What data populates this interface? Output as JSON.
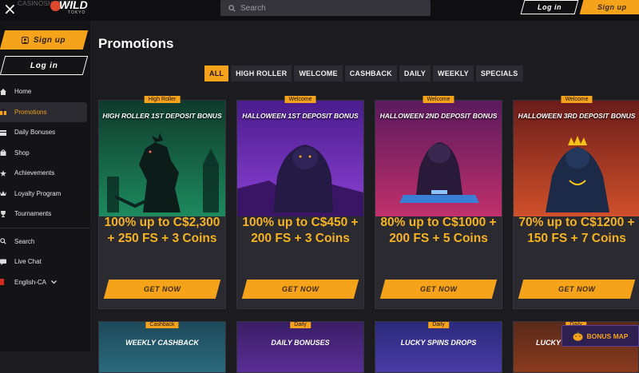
{
  "topbar": {
    "watermark": "CASINOSHUNTER",
    "logo_main": "WILD",
    "logo_sub": "TOKYO",
    "search_placeholder": "Search",
    "login": "Log in",
    "signup": "Sign up"
  },
  "sidebar": {
    "signup": "Sign up",
    "login": "Log in",
    "items": [
      {
        "label": "Home",
        "icon": "home-icon"
      },
      {
        "label": "Promotions",
        "icon": "gift-icon",
        "active": true
      },
      {
        "label": "Daily Bonuses",
        "icon": "calendar-icon"
      },
      {
        "label": "Shop",
        "icon": "bag-icon"
      },
      {
        "label": "Achievements",
        "icon": "star-icon"
      },
      {
        "label": "Loyalty Program",
        "icon": "crown-icon"
      },
      {
        "label": "Tournaments",
        "icon": "trophy-icon"
      }
    ],
    "search": "Search",
    "live_chat": "Live Chat",
    "language": "English-CA"
  },
  "main": {
    "title": "Promotions",
    "filters": [
      "ALL",
      "HIGH ROLLER",
      "WELCOME",
      "CASHBACK",
      "DAILY",
      "WEEKLY",
      "SPECIALS"
    ],
    "cards": [
      {
        "badge": "High Roller",
        "title": "HIGH ROLLER 1ST DEPOSIT BONUS",
        "offer": "100% up to C$2,300 + 250 FS + 3 Coins",
        "cta": "GET NOW"
      },
      {
        "badge": "Welcome",
        "title": "HALLOWEEN 1ST DEPOSIT BONUS",
        "offer": "100% up to C$450 + 200 FS + 3 Coins",
        "cta": "GET NOW"
      },
      {
        "badge": "Welcome",
        "title": "HALLOWEEN 2ND DEPOSIT BONUS",
        "offer": "80% up to C$1000 + 200 FS + 5 Coins",
        "cta": "GET NOW"
      },
      {
        "badge": "Welcome",
        "title": "HALLOWEEN 3RD DEPOSIT BONUS",
        "offer": "70% up to C$1200 + 150 FS + 7 Coins",
        "cta": "GET NOW"
      }
    ],
    "cards_row2": [
      {
        "badge": "Cashback",
        "title": "WEEKLY CASHBACK"
      },
      {
        "badge": "Daily",
        "title": "DAILY BONUSES"
      },
      {
        "badge": "Daily",
        "title": "LUCKY SPINS DROPS"
      },
      {
        "badge": "Daily",
        "title": "LUCKY"
      }
    ],
    "bonus_map": "BONUS MAP"
  },
  "colors": {
    "accent": "#f5a31a",
    "background": "#1b1b20",
    "sidebar": "#141417"
  }
}
